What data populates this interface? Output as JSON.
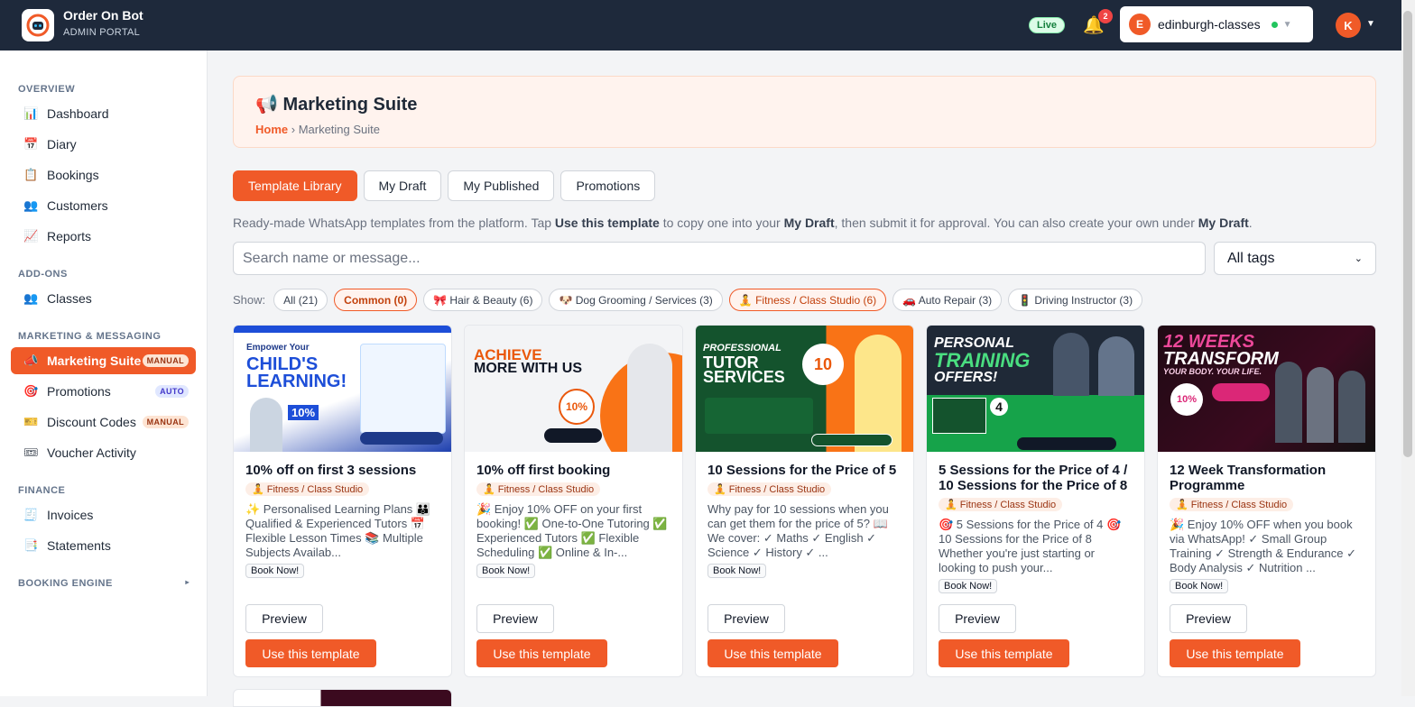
{
  "app": {
    "name": "Order On Bot",
    "subtitle": "ADMIN PORTAL",
    "live": "Live",
    "notifications": "2",
    "business": "edinburgh-classes",
    "business_initial": "E",
    "user_initial": "K"
  },
  "sidebar": {
    "overview": "OVERVIEW",
    "items_overview": [
      {
        "label": "Dashboard",
        "icon": "📊"
      },
      {
        "label": "Diary",
        "icon": "📅"
      },
      {
        "label": "Bookings",
        "icon": "📋"
      },
      {
        "label": "Customers",
        "icon": "👥"
      },
      {
        "label": "Reports",
        "icon": "📈"
      }
    ],
    "addons": "ADD-ONS",
    "classes": "Classes",
    "marketing": "MARKETING & MESSAGING",
    "marketing_suite": "Marketing Suite",
    "marketing_suite_tag": "MANUAL",
    "promotions": "Promotions",
    "promotions_tag": "AUTO",
    "discount_codes": "Discount Codes",
    "discount_tag": "MANUAL",
    "voucher": "Voucher Activity",
    "finance": "FINANCE",
    "invoices": "Invoices",
    "statements": "Statements",
    "booking_engine": "BOOKING ENGINE"
  },
  "header": {
    "title": "Marketing Suite",
    "icon": "📢",
    "crumb_home": "Home",
    "crumb_current": "› Marketing Suite"
  },
  "tabs": [
    "Template Library",
    "My Draft",
    "My Published",
    "Promotions"
  ],
  "description": {
    "p1": "Ready-made WhatsApp templates from the platform. Tap ",
    "b1": "Use this template",
    "p2": " to copy one into your ",
    "b2": "My Draft",
    "p3": ", then submit it for approval. You can also create your own under ",
    "b3": "My Draft",
    "p4": "."
  },
  "search": {
    "placeholder": "Search name or message...",
    "tags_select": "All tags"
  },
  "filters": {
    "show": "Show:",
    "chips": [
      "All (21)",
      "Common (0)",
      "🎀 Hair & Beauty (6)",
      "🐶 Dog Grooming / Services (3)",
      "🧘 Fitness / Class Studio (6)",
      "🚗 Auto Repair (3)",
      "🚦 Driving Instructor (3)"
    ]
  },
  "cards": [
    {
      "title": "10% off on first 3 sessions",
      "tag": "🧘 Fitness / Class Studio",
      "message": "✨ Personalised Learning Plans 👪 Qualified & Experienced Tutors 📅 Flexible Lesson Times 📚 Multiple Subjects Availab...",
      "cta": "Book Now!",
      "img_line1": "Empower Your",
      "img_line2": "CHILD'S",
      "img_line3": "LEARNING!",
      "img_badge": "10%"
    },
    {
      "title": "10% off first booking",
      "tag": "🧘 Fitness / Class Studio",
      "message": "🎉 Enjoy 10% OFF on your first booking! ✅ One-to-One Tutoring ✅ Experienced Tutors ✅ Flexible Scheduling ✅ Online & In-...",
      "cta": "Book Now!",
      "img_line1": "ACHIEVE",
      "img_line2": "MORE WITH US",
      "img_badge": "10%"
    },
    {
      "title": "10 Sessions for the Price of 5",
      "tag": "🧘 Fitness / Class Studio",
      "message": "Why pay for 10 sessions when you can get them for the price of 5? 📖 We cover: ✓ Maths ✓ English ✓ Science ✓ History ✓ ...",
      "cta": "Book Now!",
      "img_line1": "PROFESSIONAL",
      "img_line2": "TUTOR",
      "img_line3": "SERVICES",
      "img_badge": "10"
    },
    {
      "title": "5 Sessions for the Price of 4 / 10 Sessions for the Price of 8",
      "tag": "🧘 Fitness / Class Studio",
      "message": "🎯 5 Sessions for the Price of 4 🎯 10 Sessions for the Price of 8 Whether you're just starting or looking to push your...",
      "cta": "Book Now!",
      "img_line1": "PERSONAL",
      "img_line2": "TRAINING",
      "img_line3": "OFFERS!",
      "img_badge": "4"
    },
    {
      "title": "12 Week Transformation Programme",
      "tag": "🧘 Fitness / Class Studio",
      "message": "🎉 Enjoy 10% OFF when you book via WhatsApp! ✓ Small Group Training ✓ Strength & Endurance ✓ Body Analysis ✓ Nutrition ...",
      "cta": "Book Now!",
      "img_line1": "12 WEEKS",
      "img_line2": "TRANSFORM",
      "img_line3": "YOUR BODY. YOUR LIFE.",
      "img_badge": "10%"
    }
  ],
  "buttons": {
    "preview": "Preview",
    "use": "Use this template"
  },
  "colors": {
    "accent": "#f05a28",
    "topbar": "#1e293b"
  }
}
